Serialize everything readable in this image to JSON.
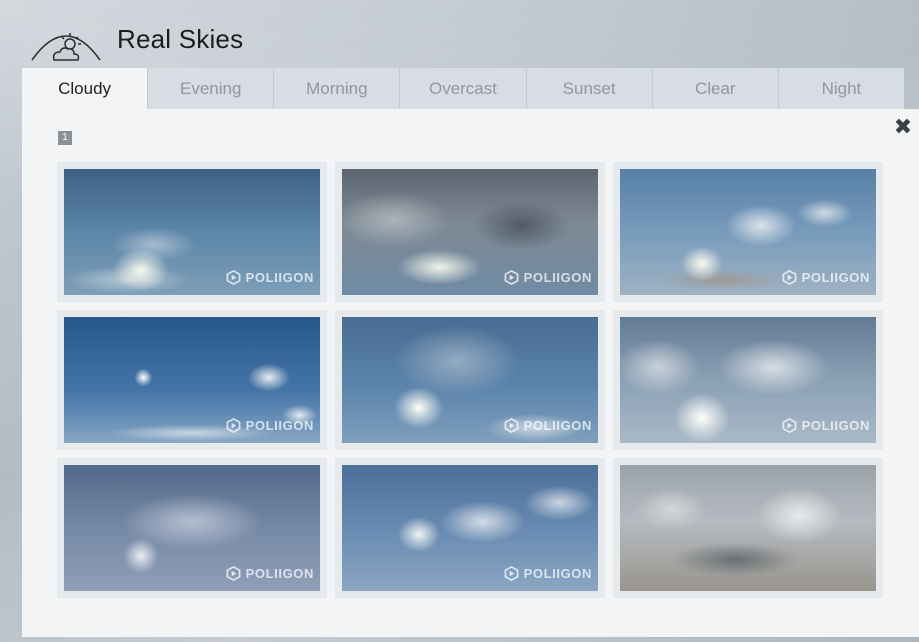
{
  "app": {
    "title": "Real Skies",
    "logo_icon": "cloud-sun-icon"
  },
  "tabs": [
    {
      "label": "Cloudy",
      "active": true
    },
    {
      "label": "Evening",
      "active": false
    },
    {
      "label": "Morning",
      "active": false
    },
    {
      "label": "Overcast",
      "active": false
    },
    {
      "label": "Sunset",
      "active": false
    },
    {
      "label": "Clear",
      "active": false
    },
    {
      "label": "Night",
      "active": false
    }
  ],
  "panel": {
    "page_number": "1",
    "close_icon": "close-icon"
  },
  "thumbnails": [
    {
      "watermark": "POLIIGON",
      "sky": "cloudy-sun-blue"
    },
    {
      "watermark": "POLIIGON",
      "sky": "dark-cloudy"
    },
    {
      "watermark": "POLIIGON",
      "sky": "scattered-cumulus"
    },
    {
      "watermark": "POLIIGON",
      "sky": "clear-sun-small-clouds"
    },
    {
      "watermark": "POLIIGON",
      "sky": "bright-sun-haze"
    },
    {
      "watermark": "POLIIGON",
      "sky": "fluffy-cumulus"
    },
    {
      "watermark": "POLIIGON",
      "sky": "wispy-cirrus"
    },
    {
      "watermark": "POLIIGON",
      "sky": "altocumulus"
    },
    {
      "watermark": "",
      "sky": "grey-storm-clouds"
    }
  ],
  "colors": {
    "active_tab_bg": "#f2f4f5",
    "inactive_tab_bg": "#d7dde2",
    "inactive_tab_text": "#8f989f",
    "panel_bg": "#f2f4f5"
  }
}
